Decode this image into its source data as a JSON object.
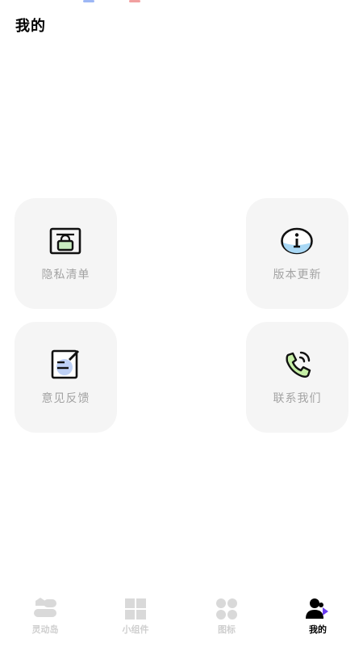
{
  "page": {
    "title": "我的"
  },
  "cards": [
    {
      "label": "隐私清单",
      "icon": "privacy-list-icon"
    },
    {
      "label": "版本更新",
      "icon": "info-icon"
    },
    {
      "label": "意见反馈",
      "icon": "feedback-edit-icon"
    },
    {
      "label": "联系我们",
      "icon": "phone-call-icon"
    }
  ],
  "tabs": [
    {
      "label": "灵动岛",
      "icon": "dynamic-island-icon",
      "active": false
    },
    {
      "label": "小组件",
      "icon": "widgets-grid-icon",
      "active": false
    },
    {
      "label": "图标",
      "icon": "icons-dots-icon",
      "active": false
    },
    {
      "label": "我的",
      "icon": "profile-users-icon",
      "active": true
    }
  ],
  "colors": {
    "card_bg": "#f5f5f5",
    "label_gray": "#a3a3a3",
    "tab_inactive": "#cfcfcf",
    "accent_blue": "#4c7ef0",
    "accent_green": "#b9e6a0",
    "accent_purple": "#6a3cf0"
  }
}
